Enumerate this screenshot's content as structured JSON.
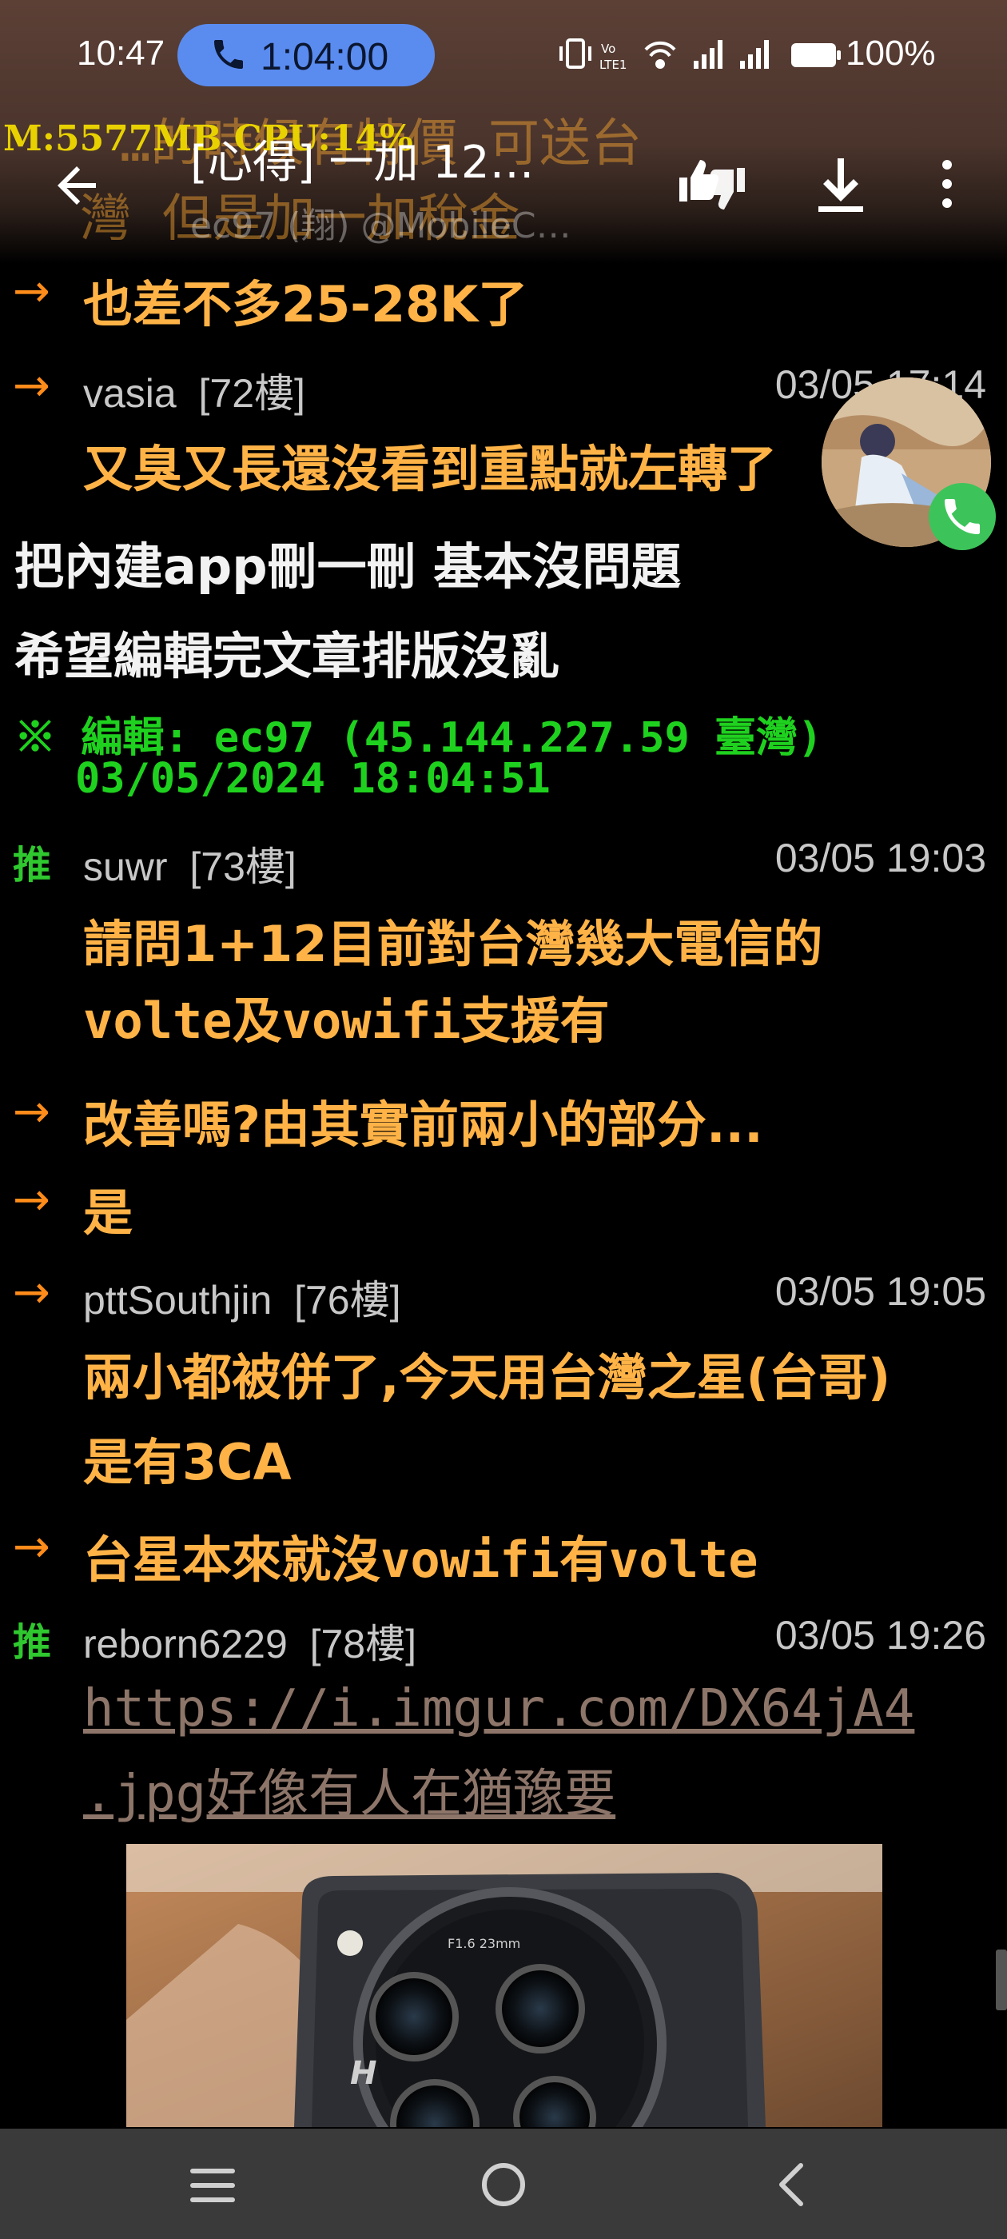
{
  "status_bar": {
    "time": "10:47",
    "call_duration": "1:04:00",
    "battery": "100%"
  },
  "toolbar": {
    "title": "[心得] 一加 12…",
    "subtitle": "ec97 (翔) @MobileC…",
    "overlay_line1": "…的時候有特價 可送台",
    "overlay_line2": "灣 但是加一加稅金",
    "perf_overlay": "M:5577MB CPU:14%"
  },
  "comments": [
    {
      "kind": "continuation",
      "text": "也差不多25-28K了"
    },
    {
      "kind": "header",
      "tag": "→",
      "author": "vasia",
      "floor": "[72樓]",
      "time": "03/05 17:14"
    },
    {
      "kind": "body",
      "text": "又臭又長還沒看到重點就左轉了"
    },
    {
      "kind": "article",
      "text": "把內建app刪一刪  基本沒問題"
    },
    {
      "kind": "article",
      "text": "希望編輯完文章排版沒亂"
    },
    {
      "kind": "edit",
      "line1": "※ 編輯: ec97 (45.144.227.59 臺灣)",
      "line2": "03/05/2024 18:04:51"
    },
    {
      "kind": "header",
      "tag": "推",
      "author": "suwr",
      "floor": "[73樓]",
      "time": "03/05 19:03"
    },
    {
      "kind": "body",
      "text": "請問1+12目前對台灣幾大電信的"
    },
    {
      "kind": "body",
      "text": "volte及vowifi支援有"
    },
    {
      "kind": "continuation",
      "text": "改善嗎?由其實前兩小的部分..."
    },
    {
      "kind": "continuation",
      "text": "是"
    },
    {
      "kind": "header",
      "tag": "→",
      "author": "pttSouthjin",
      "floor": "[76樓]",
      "time": "03/05 19:05"
    },
    {
      "kind": "body",
      "text": "兩小都被併了,今天用台灣之星(台哥)"
    },
    {
      "kind": "body",
      "text": "是有3CA"
    },
    {
      "kind": "continuation",
      "text": "台星本來就沒vowifi有volte"
    },
    {
      "kind": "header",
      "tag": "推",
      "author": "reborn6229",
      "floor": "[78樓]",
      "time": "03/05 19:26"
    },
    {
      "kind": "link",
      "text": "https://i.imgur.com/DX64jA4"
    },
    {
      "kind": "link",
      "text": ".jpg好像有人在猶豫要"
    }
  ],
  "photo": {
    "lens_text": "F1.6 23mm",
    "brand_mark": "H"
  },
  "icons": {
    "back": "arrow-left-icon",
    "rate": "thumbs-up-down-icon",
    "download": "download-icon",
    "more": "more-vert-icon",
    "call": "phone-icon"
  },
  "colors": {
    "push_text": "#ffb347",
    "arrow": "#ff8c1a",
    "push_tag": "#2fc82f",
    "edit": "#1fd11f",
    "link": "#8d7569",
    "call_pill": "#5a8cf0"
  }
}
